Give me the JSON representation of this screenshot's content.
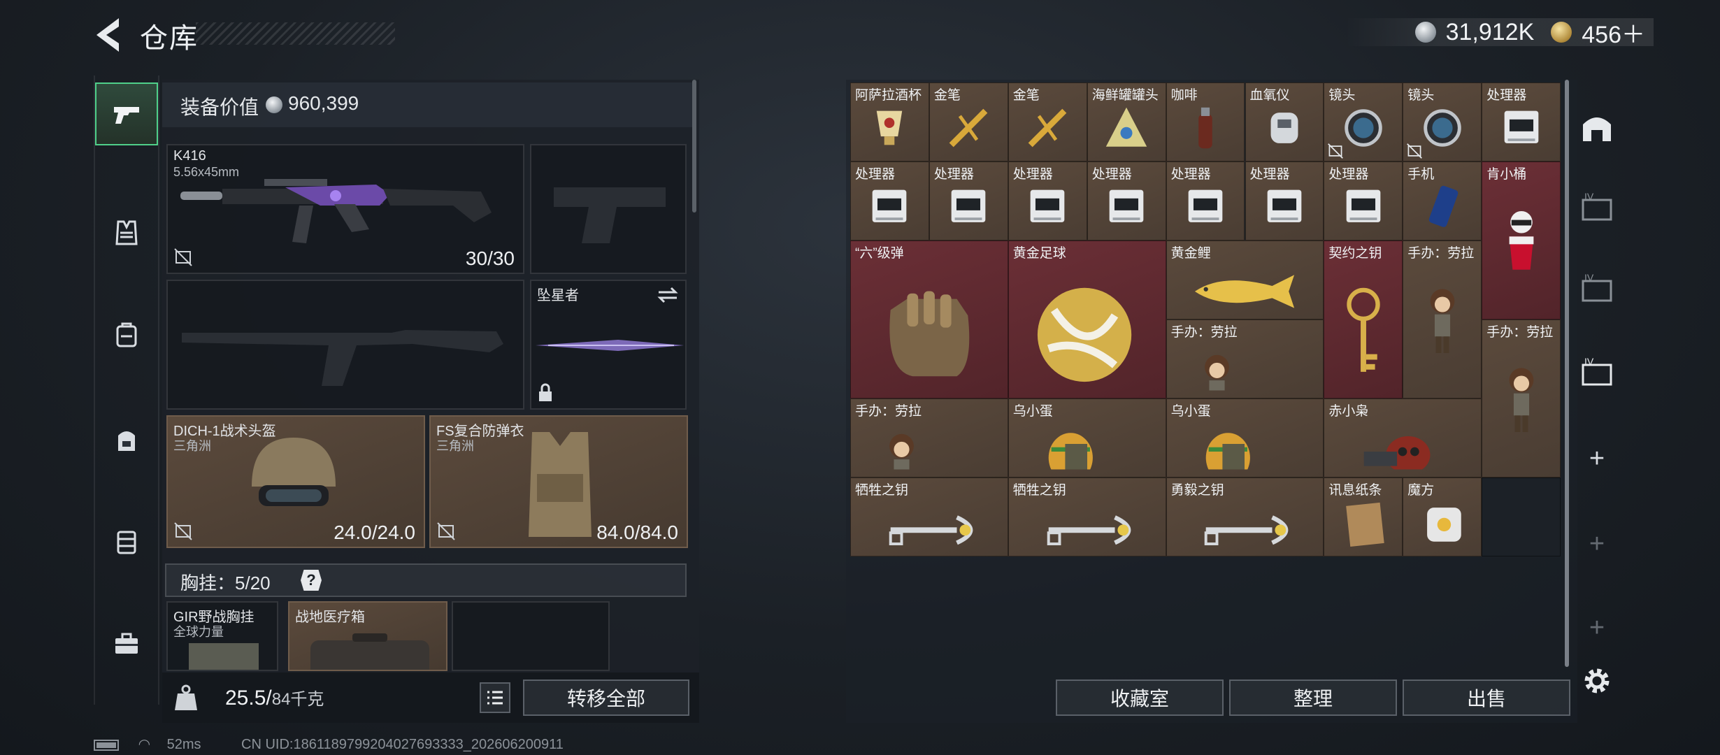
{
  "header": {
    "title": "仓库",
    "silver_amount": "31,912K",
    "gold_amount": "456＋"
  },
  "equipment": {
    "value_label": "装备价值",
    "value": "960,399"
  },
  "slots": {
    "primary": {
      "name": "K416",
      "caliber": "5.56x45mm",
      "ammo": "30/30"
    },
    "melee": {
      "name": "坠星者"
    },
    "helmet": {
      "name": "DICH-1战术头盔",
      "maker": "三角洲",
      "durability": "24.0/24.0"
    },
    "armor": {
      "name": "FS复合防弹衣",
      "maker": "三角洲",
      "durability": "84.0/84.0"
    }
  },
  "vest": {
    "label": "胸挂：",
    "count": "5/20",
    "help": "?"
  },
  "vest_items": [
    {
      "name": "GIR野战胸挂",
      "maker": "全球力量"
    },
    {
      "name": "战地医疗箱"
    }
  ],
  "footer": {
    "weight_current": "25.5/",
    "weight_max": "84千克",
    "transfer_all": "转移全部"
  },
  "storage_buttons": {
    "collection": "收藏室",
    "sort": "整理",
    "sell": "出售"
  },
  "grid_items": [
    {
      "name": "阿萨拉酒杯",
      "color": "brown"
    },
    {
      "name": "金笔",
      "color": "brown"
    },
    {
      "name": "金笔",
      "color": "brown"
    },
    {
      "name": "海鲜罐罐头",
      "color": "brown"
    },
    {
      "name": "咖啡",
      "color": "brown"
    },
    {
      "name": "血氧仪",
      "color": "brown"
    },
    {
      "name": "镜头",
      "color": "brown"
    },
    {
      "name": "镜头",
      "color": "brown"
    },
    {
      "name": "处理器",
      "color": "brown"
    },
    {
      "name": "处理器",
      "color": "brown"
    },
    {
      "name": "处理器",
      "color": "brown"
    },
    {
      "name": "处理器",
      "color": "brown"
    },
    {
      "name": "处理器",
      "color": "brown"
    },
    {
      "name": "处理器",
      "color": "brown"
    },
    {
      "name": "处理器",
      "color": "brown"
    },
    {
      "name": "处理器",
      "color": "brown"
    },
    {
      "name": "手机",
      "color": "brown"
    },
    {
      "name": "肯小桶",
      "color": "red"
    },
    {
      "name": "“六”级弹",
      "color": "red"
    },
    {
      "name": "黄金足球",
      "color": "red"
    },
    {
      "name": "黄金鲤",
      "color": "brown"
    },
    {
      "name": "契约之钥",
      "color": "red"
    },
    {
      "name": "手办：劳拉",
      "color": "brown"
    },
    {
      "name": "手办：劳拉",
      "color": "brown"
    },
    {
      "name": "手办：劳拉",
      "color": "brown"
    },
    {
      "name": "手办：劳拉",
      "color": "brown"
    },
    {
      "name": "乌小蛋",
      "color": "brown"
    },
    {
      "name": "乌小蛋",
      "color": "brown"
    },
    {
      "name": "赤小枭",
      "color": "brown"
    },
    {
      "name": "牺牲之钥",
      "color": "brown"
    },
    {
      "name": "牺牲之钥",
      "color": "brown"
    },
    {
      "name": "勇毅之钥",
      "color": "brown"
    },
    {
      "name": "讯息纸条",
      "color": "brown"
    },
    {
      "name": "魔方",
      "color": "brown"
    }
  ],
  "status": {
    "ping": "52ms",
    "uid": "CN UID:1861189799204027693333_202606200911"
  }
}
